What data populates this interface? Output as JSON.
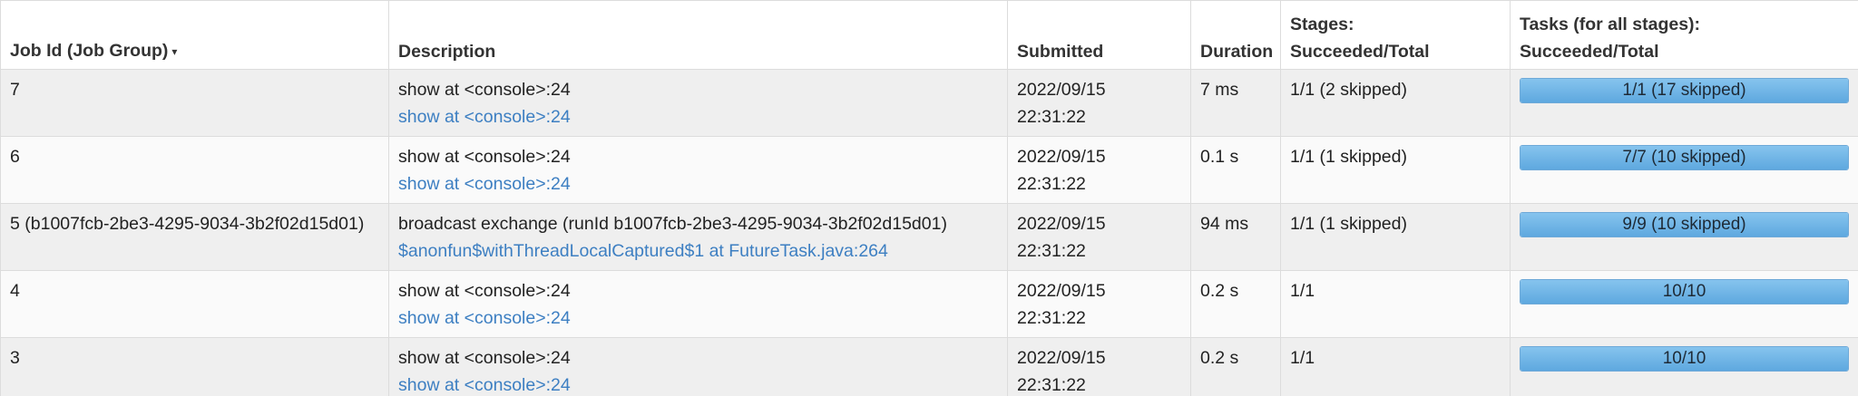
{
  "header": {
    "job_id": "Job Id (Job Group)",
    "sort_indicator": "▾",
    "description": "Description",
    "submitted": "Submitted",
    "duration": "Duration",
    "stages_line1": "Stages:",
    "stages_line2": "Succeeded/Total",
    "tasks_line1": "Tasks (for all stages):",
    "tasks_line2": "Succeeded/Total"
  },
  "rows": [
    {
      "job_id": "7",
      "description": "show at <console>:24",
      "link": "show at <console>:24",
      "submitted_date": "2022/09/15",
      "submitted_time": "22:31:22",
      "duration": "7 ms",
      "stages": "1/1 (2 skipped)",
      "tasks": "1/1 (17 skipped)",
      "tasks_progress": 1.0
    },
    {
      "job_id": "6",
      "description": "show at <console>:24",
      "link": "show at <console>:24",
      "submitted_date": "2022/09/15",
      "submitted_time": "22:31:22",
      "duration": "0.1 s",
      "stages": "1/1 (1 skipped)",
      "tasks": "7/7 (10 skipped)",
      "tasks_progress": 1.0
    },
    {
      "job_id": "5 (b1007fcb-2be3-4295-9034-3b2f02d15d01)",
      "description": "broadcast exchange (runId b1007fcb-2be3-4295-9034-3b2f02d15d01)",
      "link": "$anonfun$withThreadLocalCaptured$1 at FutureTask.java:264",
      "submitted_date": "2022/09/15",
      "submitted_time": "22:31:22",
      "duration": "94 ms",
      "stages": "1/1 (1 skipped)",
      "tasks": "9/9 (10 skipped)",
      "tasks_progress": 1.0
    },
    {
      "job_id": "4",
      "description": "show at <console>:24",
      "link": "show at <console>:24",
      "submitted_date": "2022/09/15",
      "submitted_time": "22:31:22",
      "duration": "0.2 s",
      "stages": "1/1",
      "tasks": "10/10",
      "tasks_progress": 1.0
    },
    {
      "job_id": "3",
      "description": "show at <console>:24",
      "link": "show at <console>:24",
      "submitted_date": "2022/09/15",
      "submitted_time": "22:31:22",
      "duration": "0.2 s",
      "stages": "1/1",
      "tasks": "10/10",
      "tasks_progress": 1.0
    }
  ]
}
